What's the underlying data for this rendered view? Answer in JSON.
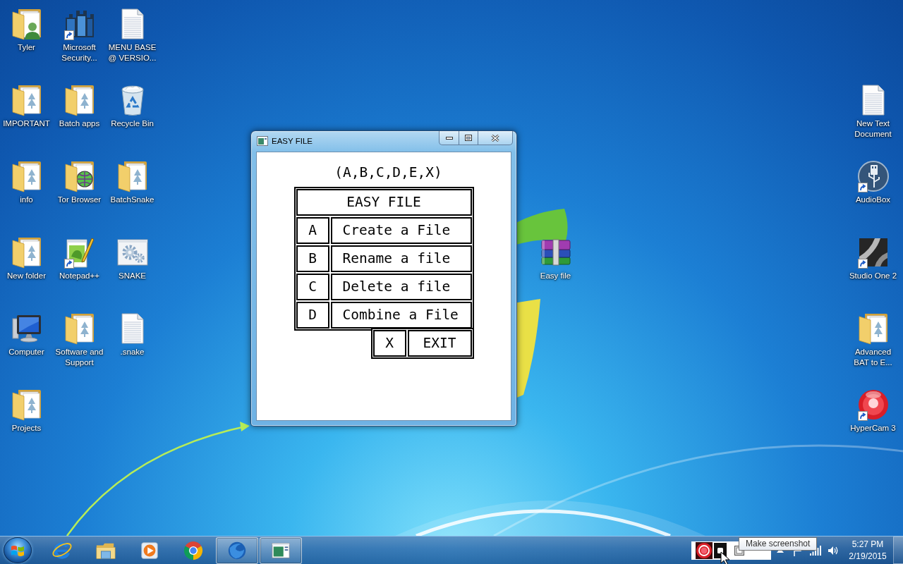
{
  "desktop": {
    "icon_rows": [
      [
        {
          "label": "Tyler",
          "kind": "user-folder",
          "shortcut": false
        },
        {
          "label": "Microsoft Security...",
          "kind": "castle",
          "shortcut": true
        },
        {
          "label": "MENU BASE @ VERSIO...",
          "kind": "text-file",
          "shortcut": false
        }
      ],
      [
        {
          "label": "IMPORTANT",
          "kind": "folder",
          "shortcut": false
        },
        {
          "label": "Batch apps",
          "kind": "folder",
          "shortcut": false
        },
        {
          "label": "Recycle Bin",
          "kind": "recycle-bin",
          "shortcut": false
        }
      ],
      [
        {
          "label": "info",
          "kind": "folder",
          "shortcut": false
        },
        {
          "label": "Tor Browser",
          "kind": "globe-folder",
          "shortcut": false
        },
        {
          "label": "BatchSnake",
          "kind": "folder",
          "shortcut": false
        }
      ],
      [
        {
          "label": "New folder",
          "kind": "folder",
          "shortcut": false
        },
        {
          "label": "Notepad++",
          "kind": "notepad",
          "shortcut": true
        },
        {
          "label": "SNAKE",
          "kind": "gear-window",
          "shortcut": false
        }
      ],
      [
        {
          "label": "Computer",
          "kind": "computer",
          "shortcut": false
        },
        {
          "label": "Software and Support",
          "kind": "folder",
          "shortcut": false
        },
        {
          "label": ".snake",
          "kind": "text-file",
          "shortcut": false
        }
      ],
      [
        {
          "label": "Projects",
          "kind": "folder",
          "shortcut": false
        }
      ]
    ],
    "center_icons": [
      {
        "label": "Easy file",
        "kind": "book-stack",
        "shortcut": false
      }
    ],
    "right_icons": [
      {
        "label": "New Text Document",
        "kind": "text-file",
        "shortcut": false
      },
      {
        "label": "AudioBox",
        "kind": "usb-circle",
        "shortcut": true
      },
      {
        "label": "Studio One 2",
        "kind": "swoosh-tile",
        "shortcut": true
      },
      {
        "label": "Advanced BAT to E...",
        "kind": "folder",
        "shortcut": false
      },
      {
        "label": "HyperCam 3",
        "kind": "record-ball",
        "shortcut": true
      }
    ]
  },
  "window": {
    "title": "EASY FILE",
    "prompt": "(A,B,C,D,E,X)",
    "menu_title": "EASY FILE",
    "options": [
      {
        "key": "A",
        "label": "Create a File"
      },
      {
        "key": "B",
        "label": "Rename a file"
      },
      {
        "key": "C",
        "label": "Delete a file"
      },
      {
        "key": "D",
        "label": "Combine a File"
      }
    ],
    "exit_option": {
      "key": "X",
      "label": "EXIT"
    }
  },
  "taskbar": {
    "pinned": [
      {
        "kind": "e-logo",
        "open": false
      },
      {
        "kind": "folder",
        "open": false
      },
      {
        "kind": "play",
        "open": false
      },
      {
        "kind": "circle-logo",
        "open": false
      },
      {
        "kind": "globe",
        "open": true
      },
      {
        "kind": "window",
        "open": true
      }
    ],
    "tooltip": "Make screenshot",
    "clock": {
      "time": "5:27 PM",
      "date": "2/19/2015"
    }
  }
}
